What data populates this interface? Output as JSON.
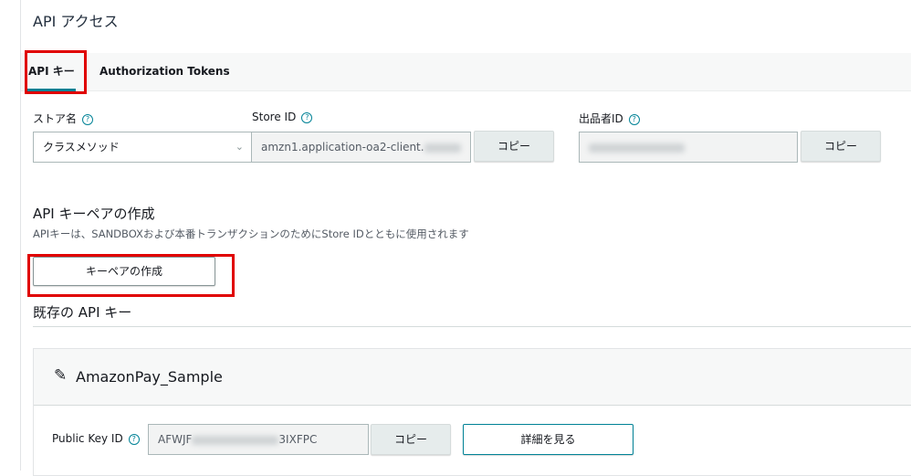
{
  "page_title": "API アクセス",
  "tabs": [
    {
      "label": "API キー",
      "active": true
    },
    {
      "label": "Authorization Tokens",
      "active": false
    }
  ],
  "store": {
    "label": "ストア名",
    "value": "クラスメソッド"
  },
  "store_id": {
    "label": "Store ID",
    "value": "amzn1.application-oa2-client.",
    "copy": "コピー"
  },
  "seller_id": {
    "label": "出品者ID",
    "copy": "コピー"
  },
  "create": {
    "heading": "API キーペアの作成",
    "description": "APIキーは、SANDBOXおよび本番トランザクションのためにStore IDとともに使用されます",
    "button": "キーペアの作成"
  },
  "existing": {
    "heading": "既存の API キー",
    "card": {
      "name": "AmazonPay_Sample",
      "public_key_label": "Public Key ID",
      "public_key_prefix": "AFWJF",
      "public_key_suffix": "3IXFPC",
      "copy": "コピー",
      "details": "詳細を見る"
    }
  },
  "colors": {
    "accent": "#008296",
    "highlight": "#e00000"
  }
}
